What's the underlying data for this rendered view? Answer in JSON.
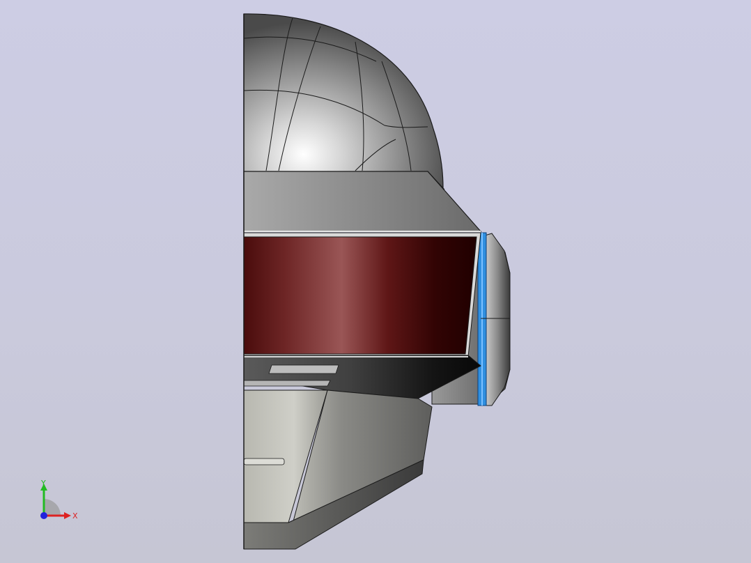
{
  "viewport": {
    "background_top": "#cdcde4",
    "background_bottom": "#c6c6d4"
  },
  "model": {
    "shell_color": "#8e8e8e",
    "visor_color": "#5a1a1a",
    "ring_accent_color": "#2f8fe0",
    "parts": [
      "dome",
      "brow-band",
      "visor",
      "ear-ring",
      "chin-guard",
      "jaw-plate"
    ]
  },
  "triad": {
    "y_label": "Y",
    "x_label": "X",
    "y_color": "#22bb22",
    "x_color": "#dd2222",
    "z_color": "#2222dd"
  }
}
